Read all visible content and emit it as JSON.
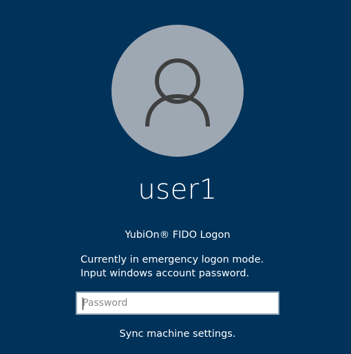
{
  "user": {
    "name": "user1",
    "avatar_icon": "user-silhouette-icon"
  },
  "credential_provider": {
    "label": "YubiOn® FIDO Logon"
  },
  "status": {
    "message": "Currently in emergency logon mode. Input windows account password."
  },
  "password": {
    "placeholder": "Password",
    "value": ""
  },
  "links": {
    "sync_label": "Sync machine settings."
  },
  "colors": {
    "background": "#00325a",
    "avatar_circle": "#9ea8b3",
    "avatar_glyph": "#404040",
    "input_border": "#8fa5b8"
  }
}
